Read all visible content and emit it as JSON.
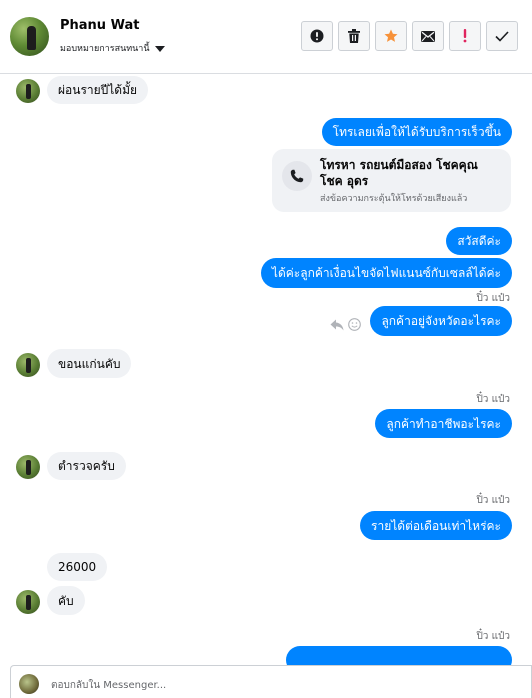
{
  "header": {
    "name": "Phanu Wat",
    "assign_label": "มอบหมายการสนทนานี้",
    "actions": [
      "alert-circle-icon",
      "trash-icon",
      "star-icon",
      "envelope-icon",
      "exclamation-icon",
      "check-icon"
    ]
  },
  "colors": {
    "accent": "#0084ff",
    "star": "#f7923a",
    "danger": "#e0245e",
    "incoming_bg": "#f0f2f5"
  },
  "messages": {
    "m1": "ผ่อนรายปีได้มั้ย",
    "m2": "โทรเลยเพื่อให้ได้รับบริการเร็วขึ้น",
    "card_title": "โทรหา รถยนต์มือสอง โชคคุณ โชค อุดร",
    "card_sub": "ส่งข้อความกระตุ้นให้โทรด้วยเสียงแล้ว",
    "m3": "สวัสดีค่ะ",
    "m4": "ได้ค่ะลูกค้าเงื่อนไขจัดไฟแนนซ์กับเซลล์ได้ค่ะ",
    "sender1": "ปิ๋ว แป๋ว",
    "m5": "ลูกค้าอยู่จังหวัดอะไรคะ",
    "m6": "ขอนแก่นคับ",
    "sender2": "ปิ๋ว แป๋ว",
    "m7": "ลูกค้าทำอาชีพอะไรคะ",
    "m8": "ตำรวจครับ",
    "sender3": "ปิ๋ว แป๋ว",
    "m9": "รายได้ต่อเดือนเท่าไหร่คะ",
    "m10": "26000",
    "m11": "คับ",
    "sender4": "ปิ๋ว แป๋ว"
  },
  "composer": {
    "placeholder": "ตอบกลับใน Messenger..."
  }
}
